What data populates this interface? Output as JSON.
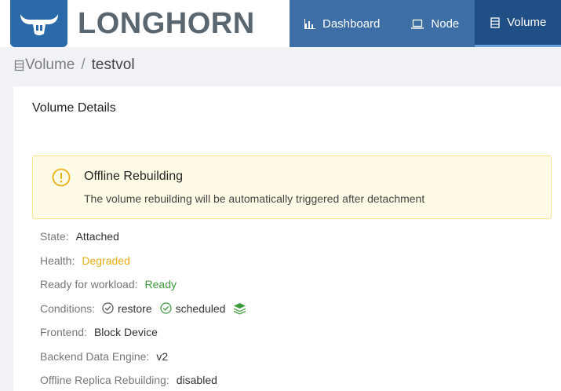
{
  "header": {
    "logo_text": "LONGHORN",
    "brand_color": "#2a6aa8",
    "nav": [
      {
        "label": "Dashboard",
        "icon": "bar-chart-icon",
        "active": false
      },
      {
        "label": "Node",
        "icon": "laptop-icon",
        "active": false
      },
      {
        "label": "Volume",
        "icon": "database-icon",
        "active": true
      }
    ]
  },
  "breadcrumb": {
    "icon": "database-icon",
    "parent": "Volume",
    "separator": "/",
    "current": "testvol"
  },
  "card": {
    "title": "Volume Details",
    "alert": {
      "icon": "exclamation-circle-icon",
      "title": "Offline Rebuilding",
      "description": "The volume rebuilding will be automatically triggered after detachment",
      "color": "#e8b015"
    },
    "details": {
      "state": {
        "label": "State:",
        "value": "Attached"
      },
      "health": {
        "label": "Health:",
        "value": "Degraded",
        "color": "#e8b015"
      },
      "ready": {
        "label": "Ready for workload:",
        "value": "Ready",
        "color": "#3b9a3b"
      },
      "conditions": {
        "label": "Conditions:",
        "items": [
          {
            "label": "restore",
            "icon": "check-circle-icon"
          },
          {
            "label": "scheduled",
            "icon": "check-circle-icon"
          }
        ],
        "extra_icon": "layers-icon"
      },
      "frontend": {
        "label": "Frontend:",
        "value": "Block Device"
      },
      "backend": {
        "label": "Backend Data Engine:",
        "value": "v2"
      },
      "offline_rebuild": {
        "label": "Offline Replica Rebuilding:",
        "value": "disabled"
      }
    }
  }
}
